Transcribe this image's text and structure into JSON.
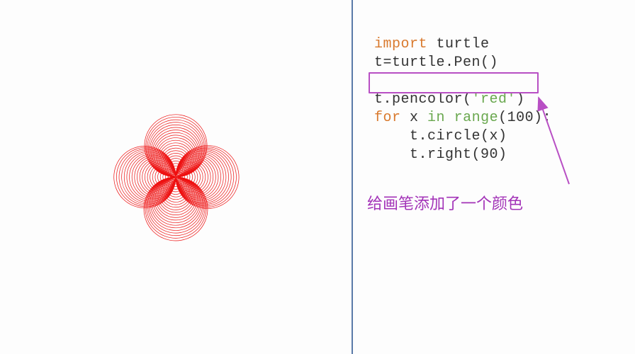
{
  "code": {
    "line1_kw": "import",
    "line1_rest": " turtle",
    "line2": "t=turtle.Pen()",
    "blank": "",
    "line3_pre": "t.pencolor(",
    "line3_arg": "'red'",
    "line3_post": ")",
    "line4_for": "for",
    "line4_var": " x ",
    "line4_in": "in",
    "line4_sp": " ",
    "line4_range": "range",
    "line4_args": "(100):",
    "line5": "    t.circle(x)",
    "line6": "    t.right(90)"
  },
  "annotation": {
    "text": "给画笔添加了一个颜色"
  },
  "colors": {
    "pen": "#e11",
    "highlight": "#b84fc4",
    "annotation": "#a333b8",
    "divider": "#5a7aa8"
  },
  "turtle": {
    "iterations": 100,
    "right_angle": 90
  }
}
